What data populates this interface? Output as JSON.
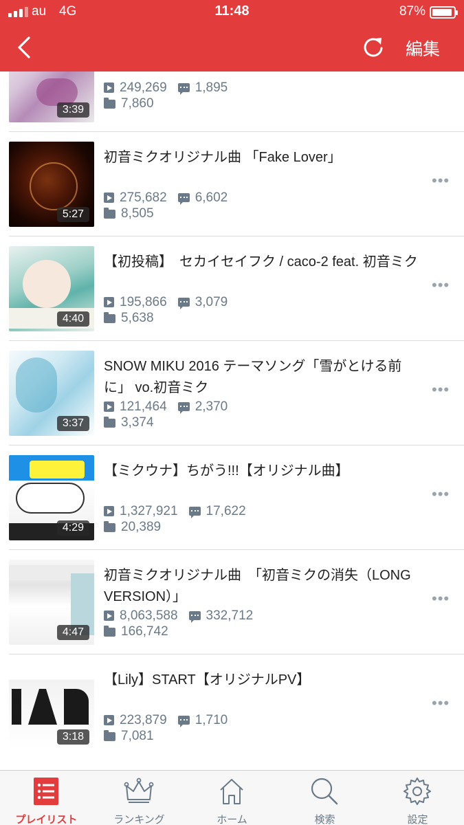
{
  "status_bar": {
    "carrier": "au",
    "network": "4G",
    "time": "11:48",
    "battery": "87%",
    "battery_level": 0.87
  },
  "header": {
    "back_icon": "chevron-left-icon",
    "refresh_icon": "refresh-icon",
    "edit_label": "編集"
  },
  "videos": [
    {
      "title": "",
      "duration": "3:39",
      "views": "249,269",
      "comments": "1,895",
      "mylists": "7,860"
    },
    {
      "title": "初音ミクオリジナル曲 「Fake Lover」",
      "duration": "5:27",
      "views": "275,682",
      "comments": "6,602",
      "mylists": "8,505"
    },
    {
      "title": "【初投稿】　セカイセイフク / caco-2 feat. 初音ミク",
      "duration": "4:40",
      "views": "195,866",
      "comments": "3,079",
      "mylists": "5,638"
    },
    {
      "title": "SNOW MIKU 2016 テーマソング「雪がとける前に」 vo.初音ミク",
      "duration": "3:37",
      "views": "121,464",
      "comments": "2,370",
      "mylists": "3,374"
    },
    {
      "title": "【ミクウナ】ちがう!!!【オリジナル曲】",
      "duration": "4:29",
      "views": "1,327,921",
      "comments": "17,622",
      "mylists": "20,389"
    },
    {
      "title": "初音ミクオリジナル曲　「初音ミクの消失（LONG VERSION）」",
      "duration": "4:47",
      "views": "8,063,588",
      "comments": "332,712",
      "mylists": "166,742"
    },
    {
      "title": "【Lily】START【オリジナルPV】",
      "duration": "3:18",
      "views": "223,879",
      "comments": "1,710",
      "mylists": "7,081"
    }
  ],
  "tabs": [
    {
      "label": "プレイリスト",
      "icon": "playlist-icon",
      "active": true
    },
    {
      "label": "ランキング",
      "icon": "crown-icon",
      "active": false
    },
    {
      "label": "ホーム",
      "icon": "home-icon",
      "active": false
    },
    {
      "label": "検索",
      "icon": "search-icon",
      "active": false
    },
    {
      "label": "設定",
      "icon": "gear-icon",
      "active": false
    }
  ],
  "colors": {
    "accent": "#e33c3c",
    "meta_text": "#6b7a88",
    "separator": "#dcdcdc",
    "tabbar_bg": "#f7f7f7"
  }
}
